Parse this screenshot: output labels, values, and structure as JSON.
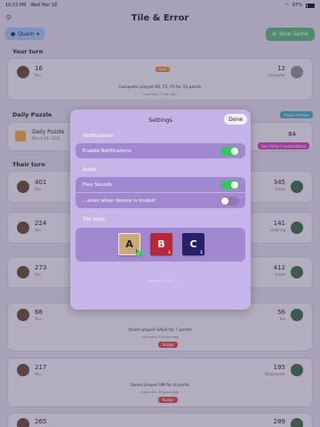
{
  "status": {
    "time": "10:23 PM",
    "date": "Wed Mar 18",
    "battery": "87%"
  },
  "app": {
    "title": "Tile & Error",
    "user": "Quam",
    "new_game": "New Game"
  },
  "your_turn": {
    "heading": "Your turn",
    "player_score": "16",
    "player_name": "You",
    "opp_score": "12",
    "opp_name": "Computer",
    "tag": "Hard",
    "message": "Computer played AR, FE, FA for 12 points",
    "time": "Last turn 1 min ago"
  },
  "daily": {
    "heading": "Daily Puzzle",
    "archive": "Puzzle Archive",
    "title": "Daily Puzzle",
    "date": "March 18, 2026",
    "score": "84",
    "leaderboard": "See Today's Leaderboard"
  },
  "their_turn": {
    "heading": "Their turn",
    "games": [
      {
        "you": "401",
        "you_label": "You",
        "opp": "345",
        "opp_label": "fonax"
      },
      {
        "you": "224",
        "you_label": "You",
        "opp": "141",
        "opp_label": "seabring"
      },
      {
        "you": "273",
        "you_label": "You",
        "opp": "412",
        "opp_label": "fonax"
      },
      {
        "you": "68",
        "you_label": "You",
        "opp": "56",
        "opp_label": "fan",
        "message": "Quam played GALA for 7 points",
        "time": "Last turn: 8 hours ago",
        "nudge": "Nudge"
      },
      {
        "you": "217",
        "you_label": "You",
        "opp": "195",
        "opp_label": "Bookmaker",
        "message": "Quam played UM for 6 points",
        "time": "Last turn: 8 hours ago",
        "nudge": "Nudge"
      },
      {
        "you": "265",
        "you_label": "You",
        "opp": "289",
        "opp_label": ""
      }
    ]
  },
  "settings": {
    "title": "Settings",
    "done": "Done",
    "notifications_label": "Notifications",
    "enable_notifications": "Enable Notifications",
    "audio_label": "Audio",
    "play_sounds": "Play Sounds",
    "muted": "...even when device is muted",
    "tile_style_label": "Tile Style",
    "tiles": [
      {
        "letter": "A",
        "value": "1",
        "selected": true
      },
      {
        "letter": "B",
        "value": "1",
        "selected": false
      },
      {
        "letter": "C",
        "value": "1",
        "selected": false
      }
    ],
    "version": "Version 1.0 (53)"
  },
  "colors": {
    "toggle_on": "#35c75a",
    "sheet": "#c5b3e6",
    "group": "#a288cf"
  }
}
